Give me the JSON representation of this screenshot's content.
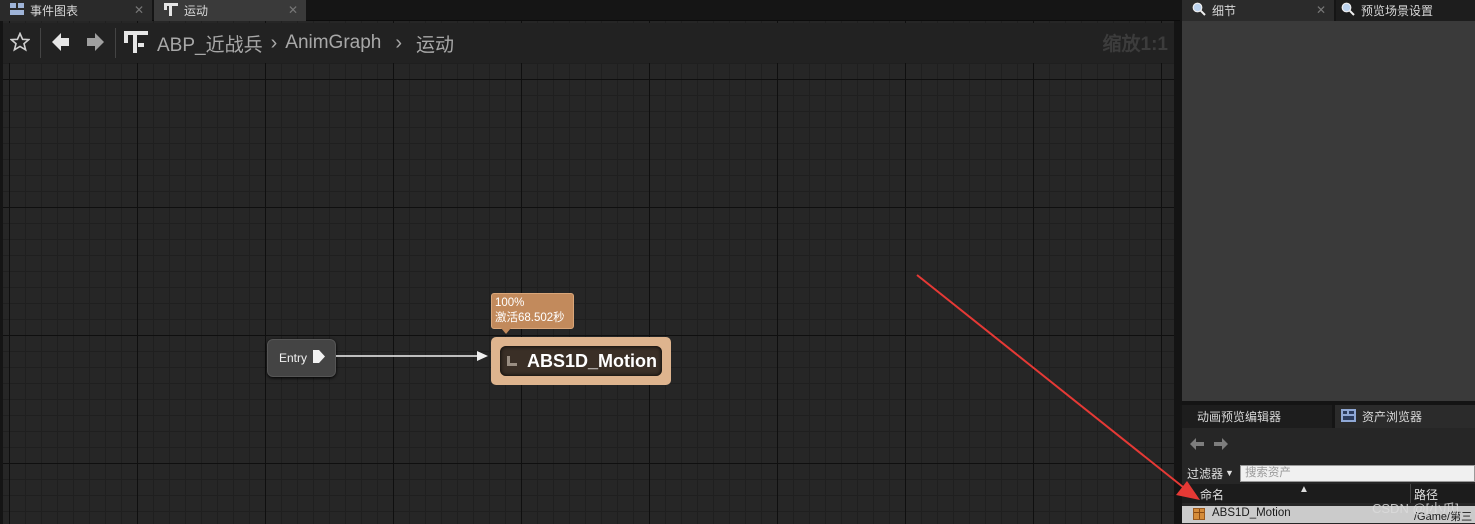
{
  "tabs": [
    {
      "label": "事件图表",
      "icon": "graph-icon"
    },
    {
      "label": "运动",
      "icon": "state-machine-icon"
    }
  ],
  "breadcrumb": {
    "asset": "ABP_近战兵",
    "graph": "AnimGraph",
    "state_machine": "运动"
  },
  "zoom": "缩放1:1",
  "graph": {
    "entry_label": "Entry",
    "state_info": {
      "weight": "100%",
      "active_time": "激活68.502秒"
    },
    "state_title": "ABS1D_Motion"
  },
  "right_panel": {
    "details_tab": "细节",
    "preview_settings_tab": "预览场景设置",
    "anim_preview_editor_tab": "动画预览编辑器",
    "asset_browser_tab": "资产浏览器",
    "filter_label": "过滤器",
    "search_placeholder": "搜索资产",
    "columns": {
      "name": "命名",
      "path": "路径"
    },
    "asset_row": {
      "name": "ABS1D_Motion",
      "path": "/Game/第三"
    }
  },
  "watermark": "CSDN @[小爪]",
  "colors": {
    "state_node": "#deb48e",
    "state_info_bg": "#c28a5c",
    "annotation_arrow": "#e53935",
    "graph_bg": "#262626"
  }
}
